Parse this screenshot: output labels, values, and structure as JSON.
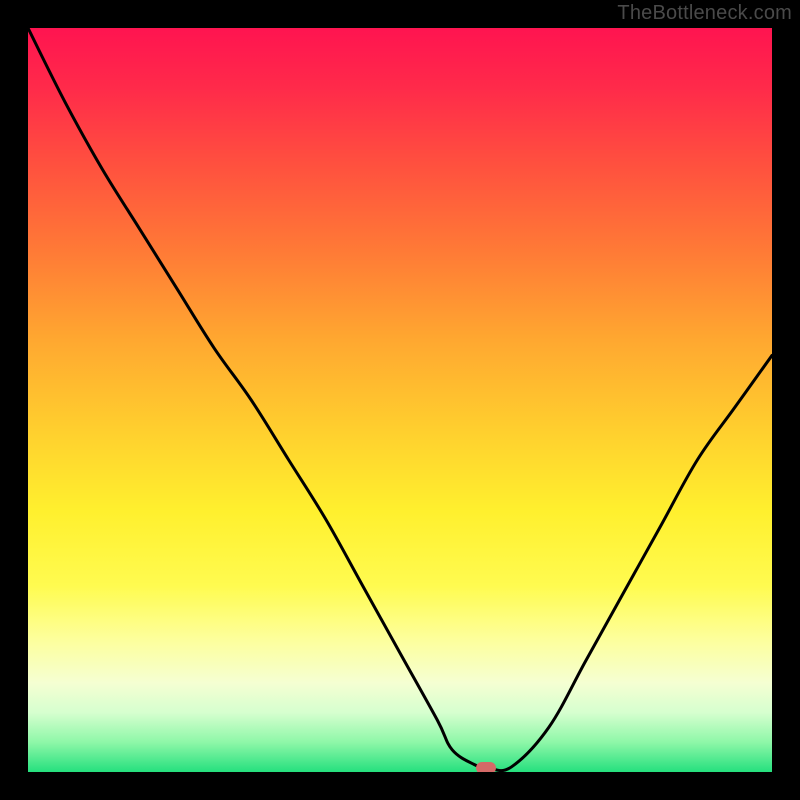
{
  "watermark": "TheBottleneck.com",
  "colors": {
    "frame": "#000000",
    "curve_stroke": "#000000",
    "marker": "#d46a67"
  },
  "chart_data": {
    "type": "line",
    "title": "",
    "xlabel": "",
    "ylabel": "",
    "xlim": [
      0,
      100
    ],
    "ylim": [
      0,
      100
    ],
    "grid": false,
    "legend": false,
    "series": [
      {
        "name": "bottleneck-curve",
        "x": [
          0,
          5,
          10,
          15,
          20,
          25,
          30,
          35,
          40,
          45,
          50,
          55,
          57,
          60,
          62,
          65,
          70,
          75,
          80,
          85,
          90,
          95,
          100
        ],
        "values": [
          100,
          90,
          81,
          73,
          65,
          57,
          50,
          42,
          34,
          25,
          16,
          7,
          3,
          1,
          0.5,
          0.7,
          6,
          15,
          24,
          33,
          42,
          49,
          56
        ]
      }
    ],
    "marker": {
      "x": 61.5,
      "y": 0.5
    },
    "gradient_stops": [
      {
        "pos": 0,
        "color": "#ff1450"
      },
      {
        "pos": 8,
        "color": "#ff2a4a"
      },
      {
        "pos": 18,
        "color": "#ff4f3f"
      },
      {
        "pos": 30,
        "color": "#ff7a36"
      },
      {
        "pos": 42,
        "color": "#ffa830"
      },
      {
        "pos": 55,
        "color": "#ffd22e"
      },
      {
        "pos": 65,
        "color": "#fff02e"
      },
      {
        "pos": 75,
        "color": "#fffb50"
      },
      {
        "pos": 82,
        "color": "#fdff9a"
      },
      {
        "pos": 88,
        "color": "#f5ffd2"
      },
      {
        "pos": 92,
        "color": "#d6ffcf"
      },
      {
        "pos": 96,
        "color": "#8ef7a8"
      },
      {
        "pos": 100,
        "color": "#25e07e"
      }
    ]
  }
}
